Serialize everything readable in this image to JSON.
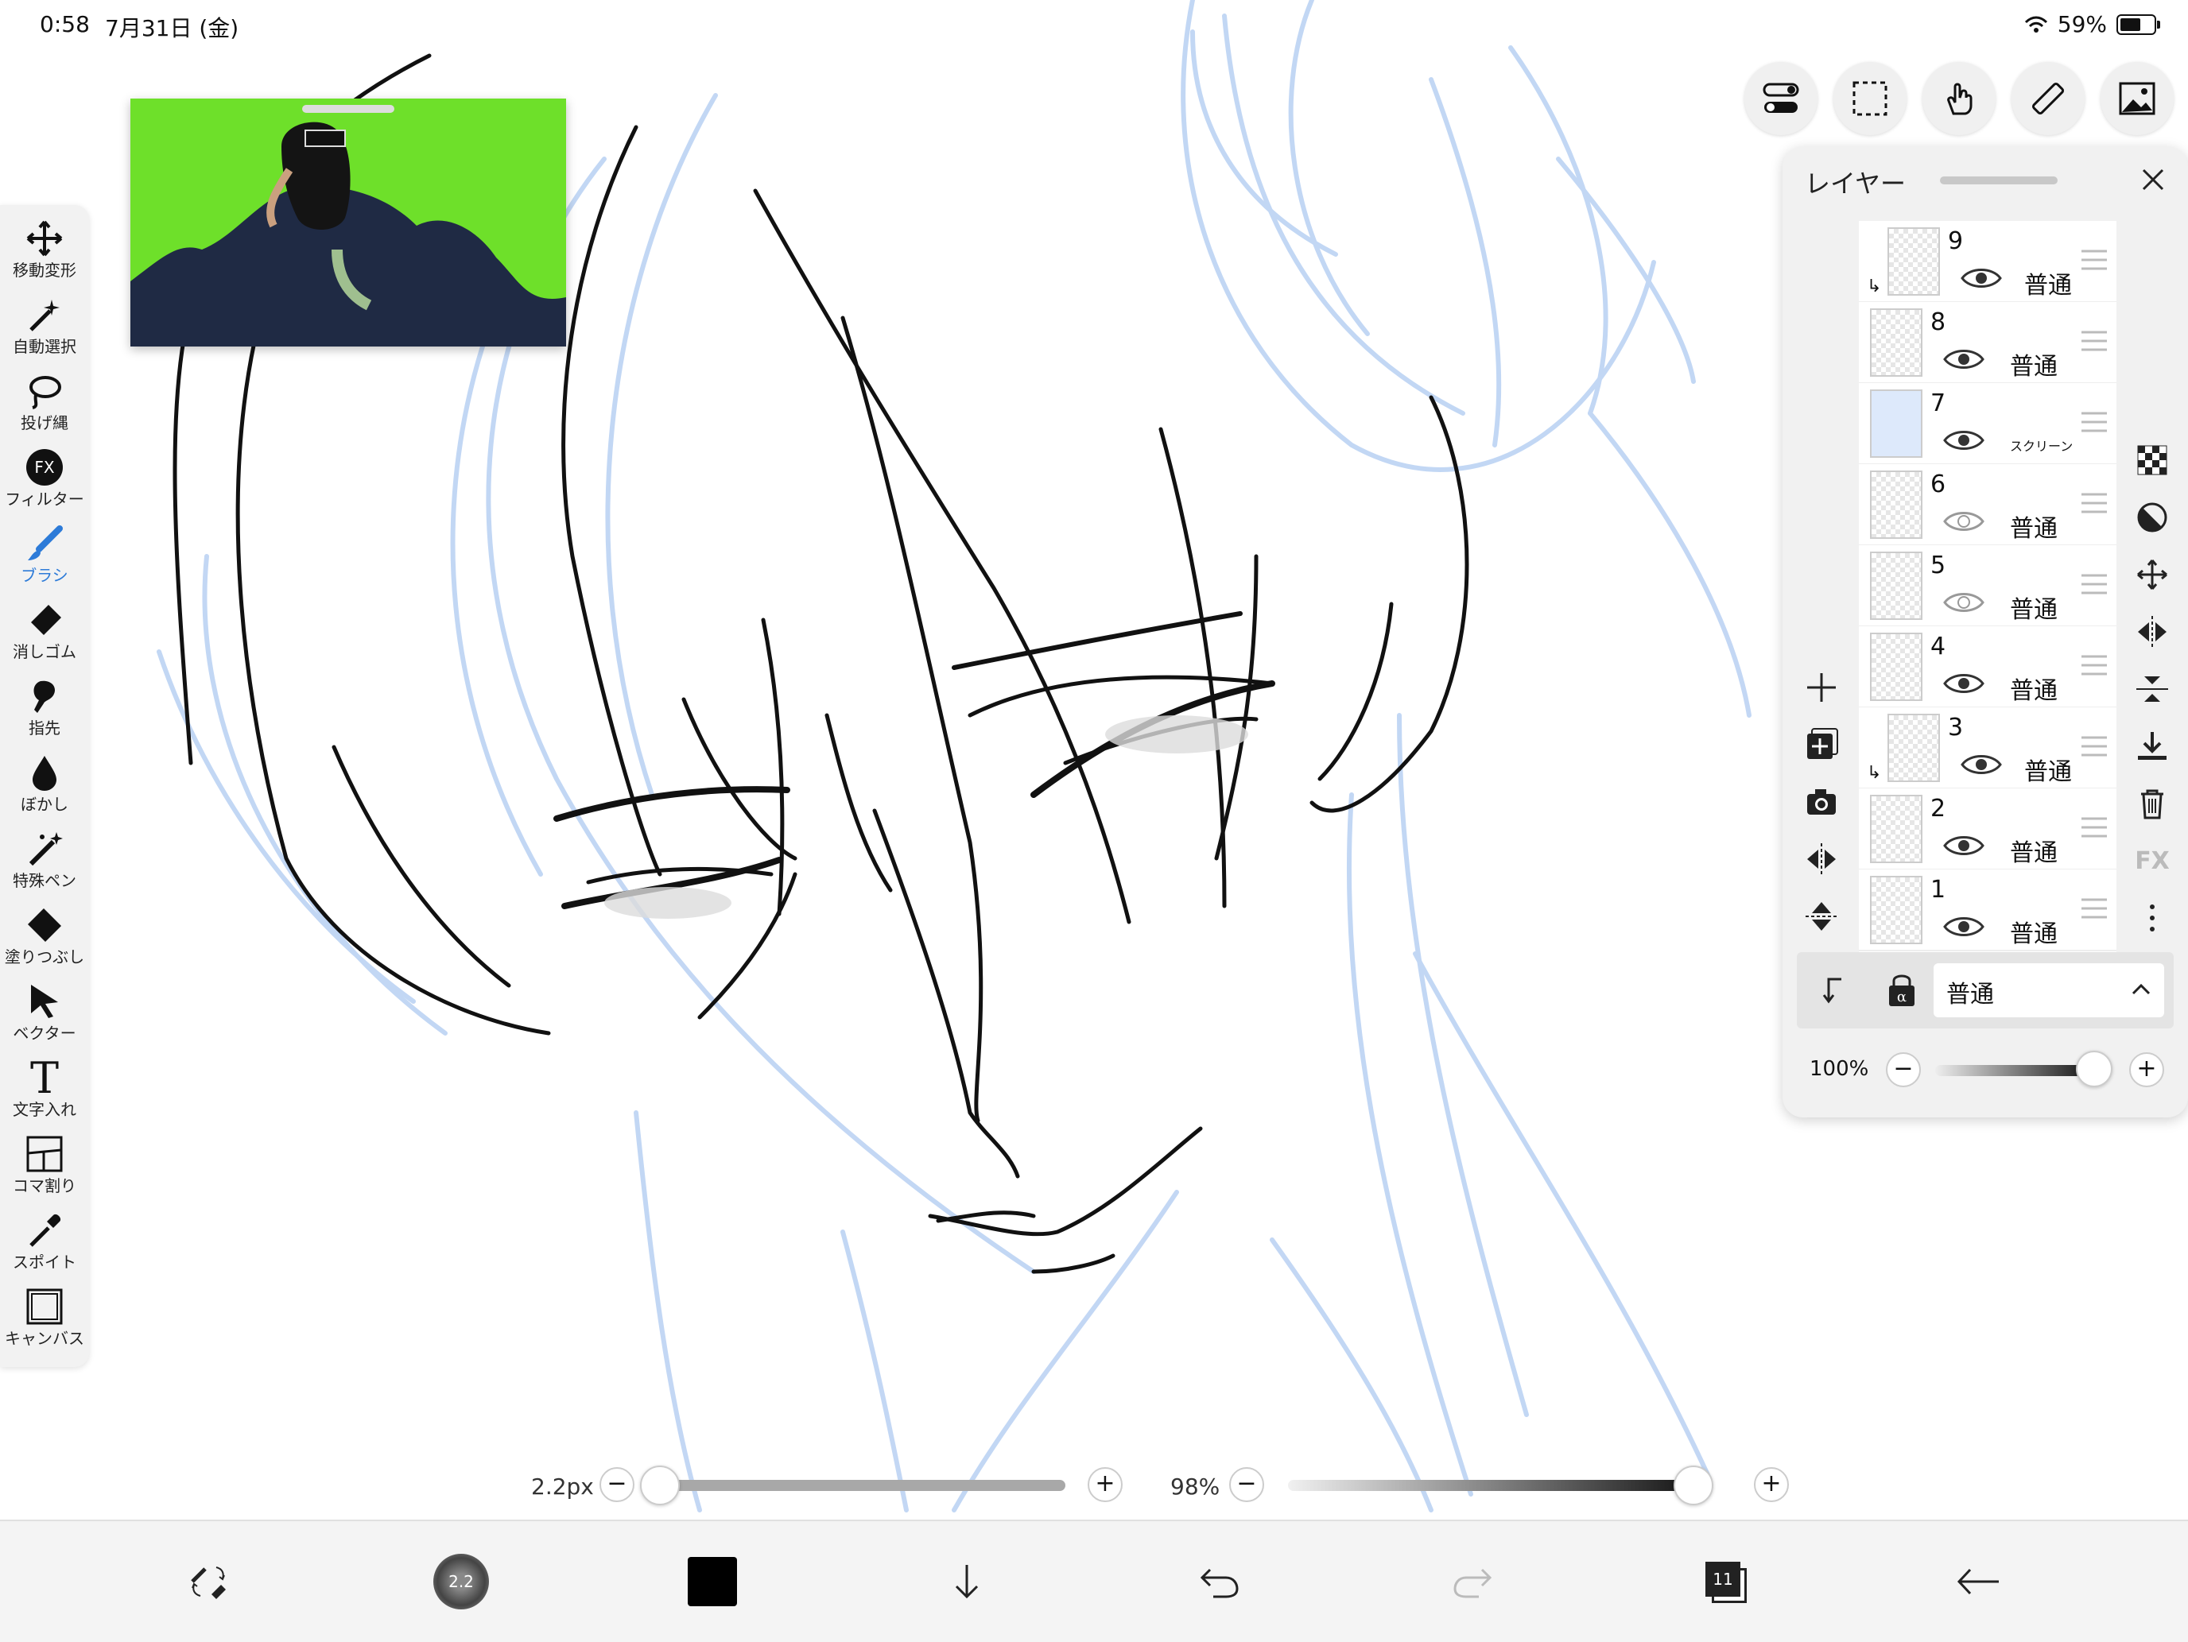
{
  "status": {
    "time": "0:58",
    "date": "7月31日 (金)",
    "battery": "59%"
  },
  "tools": [
    {
      "name": "move",
      "label": "移動変形"
    },
    {
      "name": "magic-wand",
      "label": "自動選択"
    },
    {
      "name": "lasso",
      "label": "投げ縄"
    },
    {
      "name": "filter",
      "label": "フィルター",
      "icon_text": "FX"
    },
    {
      "name": "brush",
      "label": "ブラシ",
      "active": true
    },
    {
      "name": "eraser",
      "label": "消しゴム"
    },
    {
      "name": "smudge",
      "label": "指先"
    },
    {
      "name": "blur",
      "label": "ぼかし"
    },
    {
      "name": "special-pen",
      "label": "特殊ペン"
    },
    {
      "name": "fill",
      "label": "塗りつぶし"
    },
    {
      "name": "vector",
      "label": "ベクター"
    },
    {
      "name": "text",
      "label": "文字入れ",
      "icon_text": "T"
    },
    {
      "name": "frame",
      "label": "コマ割り"
    },
    {
      "name": "eyedropper",
      "label": "スポイト"
    },
    {
      "name": "canvas",
      "label": "キャンバス"
    }
  ],
  "layer_panel": {
    "title": "レイヤー",
    "layers": [
      {
        "number": "9",
        "blend": "普通",
        "visible": true,
        "clipped": true
      },
      {
        "number": "8",
        "blend": "普通",
        "visible": true,
        "clipped": false
      },
      {
        "number": "7",
        "blend": "スクリーン",
        "visible": true,
        "clipped": false,
        "fill": "#dde9fb"
      },
      {
        "number": "6",
        "blend": "普通",
        "visible": false,
        "clipped": false
      },
      {
        "number": "5",
        "blend": "普通",
        "visible": false,
        "clipped": false
      },
      {
        "number": "4",
        "blend": "普通",
        "visible": true,
        "clipped": false
      },
      {
        "number": "3",
        "blend": "普通",
        "visible": true,
        "clipped": true
      },
      {
        "number": "2",
        "blend": "普通",
        "visible": true,
        "clipped": false
      },
      {
        "number": "1",
        "blend": "普通",
        "visible": true,
        "clipped": false
      }
    ],
    "blend_mode": "普通",
    "opacity": "100%",
    "opacity_level": 1.0,
    "side_fx_label": "FX"
  },
  "brush": {
    "size": "2.2px",
    "size_level": 0.0,
    "opacity": "98%",
    "opacity_level": 0.98,
    "thumb_label": "2.2"
  },
  "bottom": {
    "layer_count": "11",
    "color": "#000000"
  },
  "colors": {
    "accent": "#2d7bd8",
    "sketch": "#bcd3f3",
    "green_screen": "#6ee02a"
  }
}
